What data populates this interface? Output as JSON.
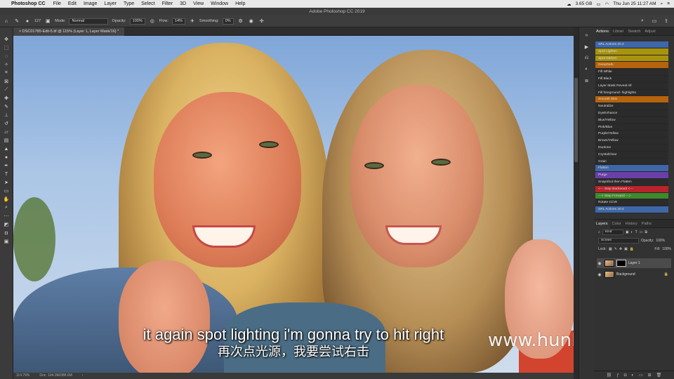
{
  "menubar": {
    "app_name": "Photoshop CC",
    "items": [
      "File",
      "Edit",
      "Image",
      "Layer",
      "Type",
      "Select",
      "Filter",
      "3D",
      "View",
      "Window",
      "Help"
    ],
    "memory": "3.65 GB",
    "datetime": "Thu Jun 25  11:27 AM"
  },
  "window": {
    "title": "Adobe Photoshop CC 2019"
  },
  "options": {
    "brush_size": "127",
    "mode_label": "Mode:",
    "mode_value": "Normal",
    "opacity_label": "Opacity:",
    "opacity_value": "100%",
    "flow_label": "Flow:",
    "flow_value": "14%",
    "smoothing_label": "Smoothing:",
    "smoothing_value": "0%"
  },
  "document": {
    "tab_title": "DSC01785-Edit-5.tif @ 115% (Layer 1, Layer Mask/16) *",
    "zoom": "114.79%",
    "doc_size": "Doc: 194.3M/388.6M"
  },
  "subtitles": {
    "english": "it again spot lighting i'm gonna try to hit right",
    "chinese": "再次点光源，我要尝试右击"
  },
  "watermark": "www.hunls.com",
  "panel_tabs": [
    "Actions",
    "Librari",
    "Swatch",
    "Adjust"
  ],
  "actions": [
    {
      "label": "SRL Actions 20.4",
      "color": "#3e67a8"
    },
    {
      "label": "Spot Lighten",
      "color": "#a8930f"
    },
    {
      "label": "Spot Darken",
      "color": "#a8930f"
    },
    {
      "label": "DeepDark",
      "color": "#b5640d"
    },
    {
      "label": "Fill White",
      "color": "#2b2b2b"
    },
    {
      "label": "Fill Black",
      "color": "#2b2b2b"
    },
    {
      "label": "Layer Mask Reveal All",
      "color": "#2b2b2b"
    },
    {
      "label": "Fill foreground- highlights",
      "color": "#2b2b2b"
    },
    {
      "label": "Smooth Skin",
      "color": "#b5640d"
    },
    {
      "label": "Neutralize",
      "color": "#2b2b2b"
    },
    {
      "label": "EyeEnhance",
      "color": "#2b2b2b"
    },
    {
      "label": "Blue/Yellow",
      "color": "#2b2b2b"
    },
    {
      "label": "Pink/Blue",
      "color": "#2b2b2b"
    },
    {
      "label": "Purple/Yellow",
      "color": "#2b2b2b"
    },
    {
      "label": "Brown/Yellow",
      "color": "#2b2b2b"
    },
    {
      "label": "Duotone",
      "color": "#2b2b2b"
    },
    {
      "label": "CrystalClear",
      "color": "#2b2b2b"
    },
    {
      "label": "Grain",
      "color": "#2b2b2b"
    },
    {
      "label": "Flatten",
      "color": "#3e67a8"
    },
    {
      "label": "Purge",
      "color": "#6a3fa8"
    },
    {
      "label": "SnapShot then Flatten",
      "color": "#2b2b2b"
    },
    {
      "label": "<--- Step Backward <---",
      "color": "#b8232c"
    },
    {
      "label": "---> Step Forward --->",
      "color": "#3d8a2a"
    },
    {
      "label": "Rotate CCW",
      "color": "#2b2b2b"
    },
    {
      "label": "SRL Actions 20.4",
      "color": "#3e67a8"
    }
  ],
  "layers_panel": {
    "tabs": [
      "Layers",
      "Color",
      "History",
      "Paths"
    ],
    "filter_label": "Kind",
    "blend_mode": "Screen",
    "opacity_label": "Opacity:",
    "opacity_value": "100%",
    "lock_label": "Lock:",
    "fill_label": "Fill:",
    "fill_value": "100%",
    "layers": [
      {
        "name": "Layer 1"
      },
      {
        "name": "Background"
      }
    ]
  }
}
